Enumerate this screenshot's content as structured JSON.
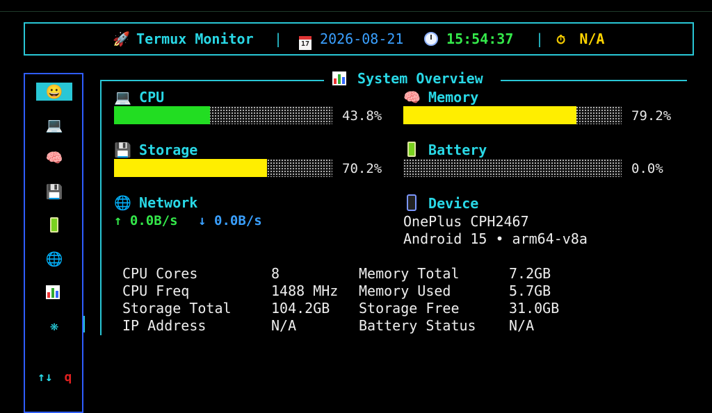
{
  "header": {
    "app_title": "Termux Monitor",
    "date": "2026-08-21",
    "time": "15:54:37",
    "separator": "|",
    "timer_value": "N/A",
    "calendar_day": "17"
  },
  "sidebar": {
    "items": [
      {
        "icon": "smiley-icon",
        "glyph": "😀",
        "active": true
      },
      {
        "icon": "laptop-icon",
        "glyph": "💻"
      },
      {
        "icon": "brain-icon",
        "glyph": "🧠"
      },
      {
        "icon": "floppy-disk-icon",
        "glyph": "💾"
      },
      {
        "icon": "battery-icon",
        "glyph": "🔋"
      },
      {
        "icon": "globe-icon",
        "glyph": "🌐"
      },
      {
        "icon": "bar-chart-icon",
        "glyph": "📊"
      },
      {
        "icon": "gear-icon",
        "glyph": "❋"
      }
    ],
    "scroll_hint": "↑↓",
    "quit_key": "q"
  },
  "panel": {
    "title": "System Overview",
    "cpu": {
      "label": "CPU",
      "percent": 43.8,
      "percent_text": "43.8%",
      "color": "#22dd22"
    },
    "memory": {
      "label": "Memory",
      "percent": 79.2,
      "percent_text": "79.2%",
      "color": "#ffee00"
    },
    "storage": {
      "label": "Storage",
      "percent": 70.2,
      "percent_text": "70.2%",
      "color": "#ffee00"
    },
    "battery": {
      "label": "Battery",
      "percent": 0.0,
      "percent_text": "0.0%",
      "color": "#22dd22"
    },
    "network": {
      "label": "Network",
      "up": "↑ 0.0B/s",
      "down": "↓ 0.0B/s"
    },
    "device": {
      "label": "Device",
      "model": "OnePlus CPH2467",
      "os": "Android 15 • arm64-v8a"
    },
    "details": [
      {
        "k1": "CPU Cores",
        "v1": "8",
        "k2": "Memory Total",
        "v2": "7.2GB"
      },
      {
        "k1": "CPU Freq",
        "v1": "1488 MHz",
        "k2": "Memory Used",
        "v2": "5.7GB"
      },
      {
        "k1": "Storage Total",
        "v1": "104.2GB",
        "k2": "Storage Free",
        "v2": "31.0GB"
      },
      {
        "k1": "IP Address",
        "v1": "N/A",
        "k2": "Battery Status",
        "v2": "N/A"
      }
    ]
  },
  "colors": {
    "accent": "#29c7d6",
    "sidebar_border": "#2f5dff",
    "time": "#34e84a",
    "date": "#3aa0ff",
    "timer": "#ffd400"
  }
}
